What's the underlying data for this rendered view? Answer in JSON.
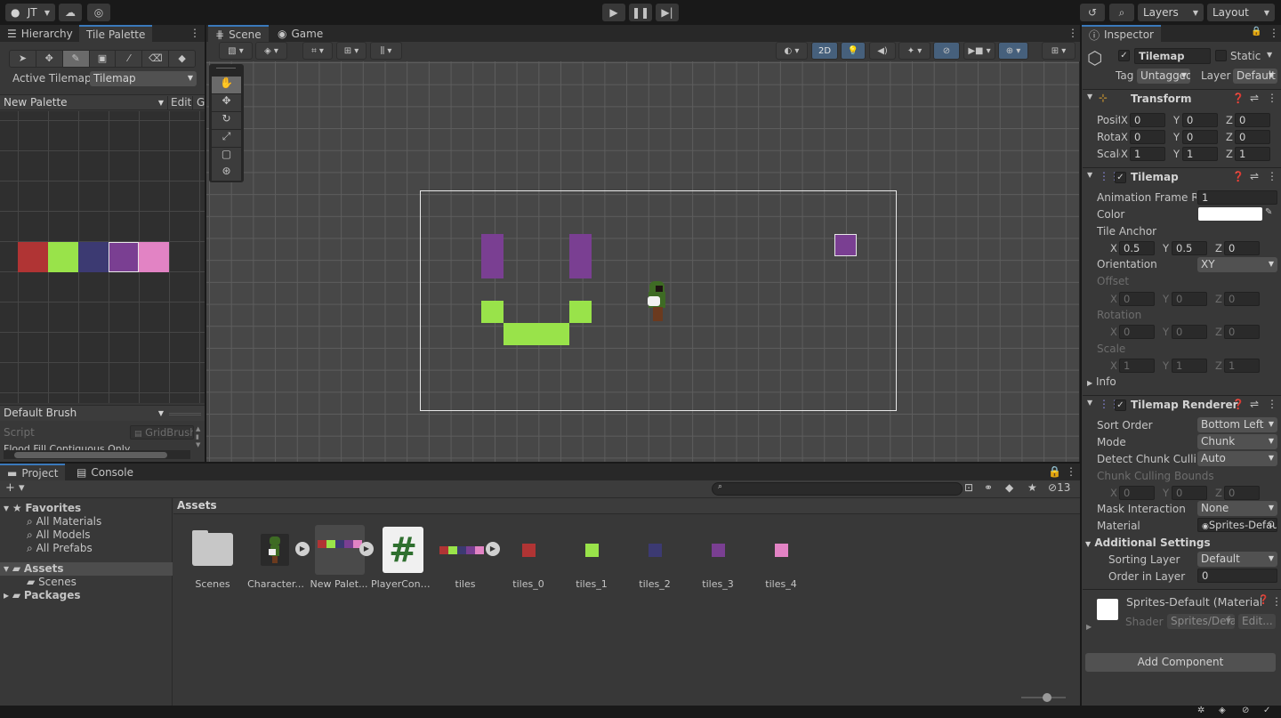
{
  "toolbar": {
    "account": "JT",
    "layers_label": "Layers",
    "layout_label": "Layout",
    "play_icon": "play-icon",
    "pause_icon": "pause-icon",
    "step_icon": "step-icon"
  },
  "left_panel": {
    "tabs": [
      "Hierarchy",
      "Tile Palette"
    ],
    "active_tilemap_label": "Active Tilemap",
    "active_tilemap_value": "Tilemap",
    "palette_value": "New Palette",
    "edit_label": "Edit",
    "g_label": "G",
    "brush_value": "Default Brush",
    "script_label": "Script",
    "script_value": "GridBrush",
    "flood_fill_label": "Flood Fill Contiguous Only",
    "palette_tiles": [
      "#b03434",
      "#99e34a",
      "#3c3a72",
      "#7a3f92",
      "#e283c4"
    ]
  },
  "scene": {
    "tabs": [
      "Scene",
      "Game"
    ],
    "mode_2d": "2D"
  },
  "bottom": {
    "tabs": [
      "Project",
      "Console"
    ],
    "hidden_count": "13",
    "favorites_label": "Favorites",
    "favorites": [
      "All Materials",
      "All Models",
      "All Prefabs"
    ],
    "assets_label": "Assets",
    "assets_children": [
      "Scenes"
    ],
    "packages_label": "Packages",
    "breadcrumb": "Assets",
    "items": [
      {
        "name": "Scenes",
        "kind": "folder"
      },
      {
        "name": "Character...",
        "kind": "sprite"
      },
      {
        "name": "New Palet...",
        "kind": "palette"
      },
      {
        "name": "PlayerCont...",
        "kind": "script"
      },
      {
        "name": "tiles",
        "kind": "sheet"
      },
      {
        "name": "tiles_0",
        "kind": "tile",
        "color": "#b03434"
      },
      {
        "name": "tiles_1",
        "kind": "tile",
        "color": "#99e34a"
      },
      {
        "name": "tiles_2",
        "kind": "tile",
        "color": "#3c3a72"
      },
      {
        "name": "tiles_3",
        "kind": "tile",
        "color": "#7a3f92"
      },
      {
        "name": "tiles_4",
        "kind": "tile",
        "color": "#e283c4"
      }
    ]
  },
  "inspector": {
    "tab": "Inspector",
    "object_name": "Tilemap",
    "static_label": "Static",
    "tag_label": "Tag",
    "tag_value": "Untagged",
    "layer_label": "Layer",
    "layer_value": "Default",
    "transform": {
      "title": "Transform",
      "rows": [
        {
          "label": "Position",
          "x": "0",
          "y": "0",
          "z": "0"
        },
        {
          "label": "Rotation",
          "x": "0",
          "y": "0",
          "z": "0"
        },
        {
          "label": "Scale",
          "x": "1",
          "y": "1",
          "z": "1"
        }
      ]
    },
    "tilemap": {
      "title": "Tilemap",
      "anim_label": "Animation Frame Rate",
      "anim_value": "1",
      "color_label": "Color",
      "color_value": "#ffffff",
      "anchor_label": "Tile Anchor",
      "anchor": {
        "x": "0.5",
        "y": "0.5",
        "z": "0"
      },
      "orientation_label": "Orientation",
      "orientation_value": "XY",
      "offset_label": "Offset",
      "offset": {
        "x": "0",
        "y": "0",
        "z": "0"
      },
      "rotation_label": "Rotation",
      "rotation": {
        "x": "0",
        "y": "0",
        "z": "0"
      },
      "scale_label": "Scale",
      "scale": {
        "x": "1",
        "y": "1",
        "z": "1"
      },
      "info_label": "Info"
    },
    "renderer": {
      "title": "Tilemap Renderer",
      "sort_order_label": "Sort Order",
      "sort_order_value": "Bottom Left",
      "mode_label": "Mode",
      "mode_value": "Chunk",
      "detect_label": "Detect Chunk Culling Bounds",
      "detect_value": "Auto",
      "chunk_bounds_label": "Chunk Culling Bounds",
      "chunk_bounds": {
        "x": "0",
        "y": "0",
        "z": "0"
      },
      "mask_label": "Mask Interaction",
      "mask_value": "None",
      "material_label": "Material",
      "material_value": "Sprites-Default",
      "additional_label": "Additional Settings",
      "sorting_layer_label": "Sorting Layer",
      "sorting_layer_value": "Default",
      "order_label": "Order in Layer",
      "order_value": "0"
    },
    "material_block": {
      "name": "Sprites-Default (Material)",
      "shader_label": "Shader",
      "shader_value": "Sprites/Default",
      "edit_label": "Edit..."
    },
    "add_component": "Add Component"
  },
  "colors": {
    "purple": "#7a3f92",
    "green": "#99e34a",
    "accent": "#3a79bb"
  }
}
